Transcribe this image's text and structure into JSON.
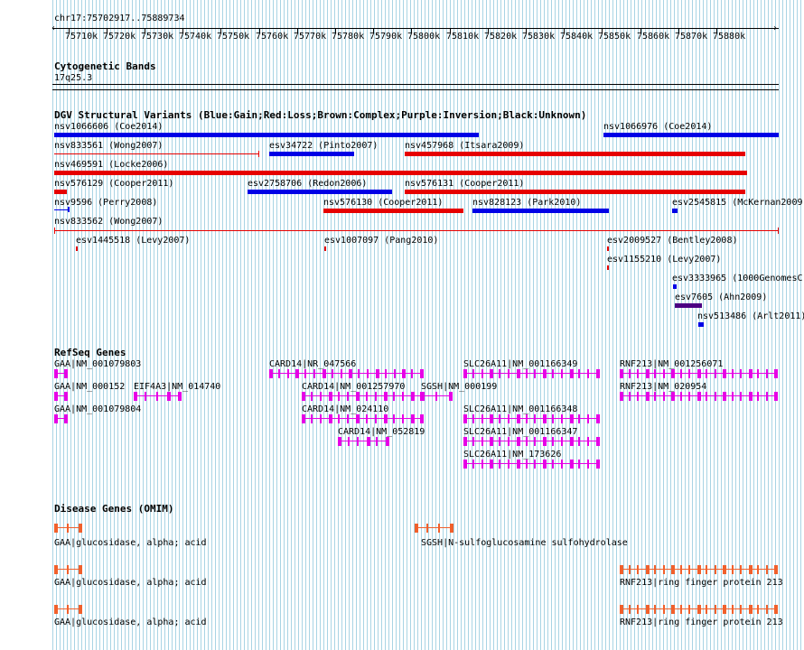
{
  "ruler": {
    "location": "chr17:75702917..75889734",
    "ticks": [
      "75710k",
      "75720k",
      "75730k",
      "75740k",
      "75750k",
      "75760k",
      "75770k",
      "75780k",
      "75790k",
      "75800k",
      "75810k",
      "75820k",
      "75830k",
      "75840k",
      "75850k",
      "75860k",
      "75870k",
      "75880k"
    ]
  },
  "cytoband": {
    "title": "Cytogenetic Bands",
    "band": "17q25.3"
  },
  "dgv": {
    "title": "DGV Structural Variants (Blue:Gain;Red:Loss;Brown:Complex;Purple:Inversion;Black:Unknown)",
    "colors": {
      "gain": "#0000e6",
      "loss": "#e60000",
      "inversion": "#4b0082",
      "complex": "#8b4513",
      "unknown": "#000000"
    },
    "variants": [
      {
        "label": "nsv1066606 (Coe2014)",
        "type": "gain"
      },
      {
        "label": "nsv1066976 (Coe2014)",
        "type": "gain"
      },
      {
        "label": "nsv833561 (Wong2007)",
        "type": "loss"
      },
      {
        "label": "esv34722 (Pinto2007)",
        "type": "gain"
      },
      {
        "label": "nsv457968 (Itsara2009)",
        "type": "loss"
      },
      {
        "label": "nsv469591 (Locke2006)",
        "type": "loss"
      },
      {
        "label": "nsv576129 (Cooper2011)",
        "type": "loss"
      },
      {
        "label": "esv2758706 (Redon2006)",
        "type": "gain"
      },
      {
        "label": "nsv576131 (Cooper2011)",
        "type": "loss"
      },
      {
        "label": "nsv9596 (Perry2008)",
        "type": "gain"
      },
      {
        "label": "nsv576130 (Cooper2011)",
        "type": "loss"
      },
      {
        "label": "nsv828123 (Park2010)",
        "type": "gain"
      },
      {
        "label": "esv2545815 (McKernan2009)",
        "type": "gain"
      },
      {
        "label": "nsv833562 (Wong2007)",
        "type": "loss"
      },
      {
        "label": "esv1445518 (Levy2007)",
        "type": "loss"
      },
      {
        "label": "esv1007097 (Pang2010)",
        "type": "loss"
      },
      {
        "label": "esv2009527 (Bentley2008)",
        "type": "loss"
      },
      {
        "label": "esv1155210 (Levy2007)",
        "type": "loss"
      },
      {
        "label": "esv3333965 (1000GenomesC",
        "type": "gain"
      },
      {
        "label": "esv7605 (Ahn2009)",
        "type": "inversion"
      },
      {
        "label": "nsv513486 (Arlt2011)",
        "type": "gain"
      }
    ]
  },
  "refseq": {
    "title": "RefSeq Genes",
    "color": "#e600e6",
    "genes": [
      "GAA|NM_001079803",
      "CARD14|NR_047566",
      "SLC26A11|NM_001166349",
      "RNF213|NM_001256071",
      "GAA|NM_000152",
      "EIF4A3|NM_014740",
      "CARD14|NM_001257970",
      "SGSH|NM_000199",
      "RNF213|NM_020954",
      "GAA|NM_001079804",
      "CARD14|NM_024110",
      "SLC26A11|NM_001166348",
      "CARD14|NM_052819",
      "SLC26A11|NM_001166347",
      "SLC26A11|NM_173626"
    ]
  },
  "omim": {
    "title": "Disease Genes (OMIM)",
    "color": "#f0602c",
    "genes": [
      "GAA|glucosidase, alpha; acid",
      "SGSH|N-sulfoglucosamine sulfohydrolase",
      "GAA|glucosidase, alpha; acid",
      "RNF213|ring finger protein 213",
      "GAA|glucosidase, alpha; acid",
      "RNF213|ring finger protein 213"
    ]
  }
}
